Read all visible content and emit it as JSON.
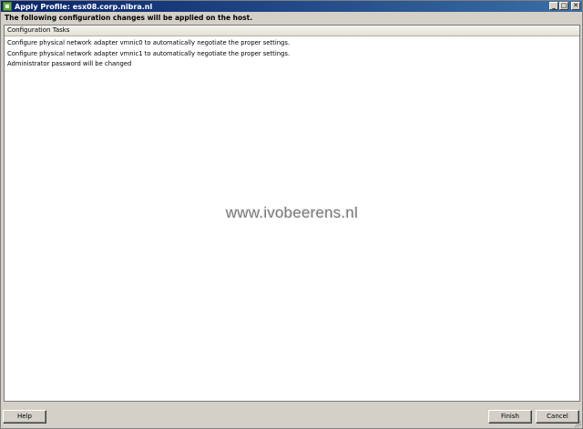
{
  "window": {
    "title": "Apply Profile: esx08.corp.nibra.nl",
    "controls": {
      "minimize": "_",
      "maximize": "□",
      "close": "✕"
    }
  },
  "header": {
    "message": "The following configuration changes will be applied on the host."
  },
  "tasks": {
    "column_header": "Configuration Tasks",
    "rows": [
      "Configure physical network adapter vmnic0 to automatically negotiate the proper settings.",
      "Configure physical network adapter vmnic1 to automatically negotiate the proper settings.",
      "Administrator password will be changed"
    ]
  },
  "watermark": "www.ivobeerens.nl",
  "footer": {
    "help_label": "Help",
    "finish_label": "Finish",
    "cancel_label": "Cancel"
  },
  "icons": {
    "app": "vsphere-profile-icon"
  }
}
